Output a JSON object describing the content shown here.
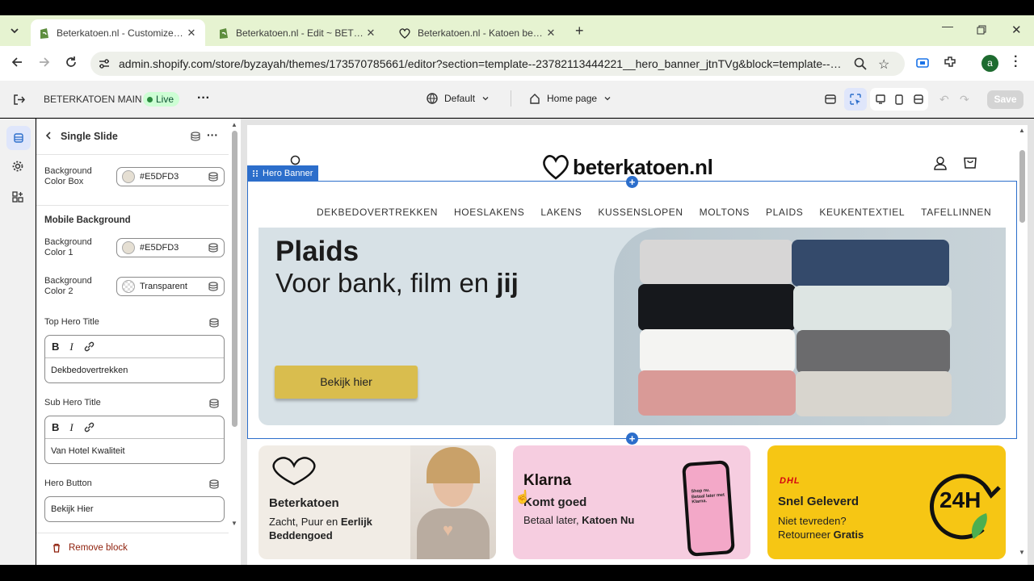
{
  "browser": {
    "tabs": [
      {
        "title": "Beterkatoen.nl - Customize BETERKATOEN MAIN",
        "icon": "shopify-icon"
      },
      {
        "title": "Beterkatoen.nl - Edit ~ BETERKATOEN MAIN",
        "icon": "shopify-icon"
      },
      {
        "title": "Beterkatoen.nl - Katoen beddengoed",
        "icon": "heart-icon"
      }
    ],
    "url": "admin.shopify.com/store/byzayah/themes/173570785661/editor?section=template--23782113444221__hero_banner_jtnTVg&block=template--23782113...",
    "profile_initial": "a"
  },
  "editor": {
    "theme_name": "BETERKATOEN MAIN",
    "live_badge": "Live",
    "more": "···",
    "template_select": "Default",
    "page_select": "Home page",
    "save_label": "Save"
  },
  "panel": {
    "title": "Single Slide",
    "bg_box_label": "Background Color Box",
    "bg_box_value": "#E5DFD3",
    "mobile_heading": "Mobile Background",
    "bg1_label": "Background Color 1",
    "bg1_value": "#E5DFD3",
    "bg2_label": "Background Color 2",
    "bg2_value": "Transparent",
    "top_title_label": "Top Hero Title",
    "top_title_value": "Dekbedovertrekken",
    "sub_title_label": "Sub Hero Title",
    "sub_title_value": "Van Hotel Kwaliteit",
    "hero_button_label": "Hero Button",
    "hero_button_value": "Bekijk Hier",
    "remove_label": "Remove block",
    "bold": "B",
    "italic": "I"
  },
  "site": {
    "logo": "beterkatoen.nl",
    "section_tag": "Hero Banner",
    "nav": [
      "DEKBEDOVERTREKKEN",
      "HOESLAKENS",
      "LAKENS",
      "KUSSENSLOPEN",
      "MOLTONS",
      "PLAIDS",
      "KEUKENTEXTIEL",
      "TAFELLINNEN"
    ],
    "hero": {
      "title": "Plaids",
      "subtitle_pre": "Voor bank, film en ",
      "subtitle_bold": "jij",
      "button": "Bekijk hier"
    },
    "cards": [
      {
        "heading": "Beterkatoen",
        "line1_pre": "Zacht, Puur en ",
        "line1_bold": "Eerlijk Beddengoed"
      },
      {
        "brand": "Klarna",
        "heading": "Komt goed",
        "line1_pre": "Betaal later, ",
        "line1_bold": "Katoen Nu",
        "phone_text": "Shop nu. Betaal later met Klarna."
      },
      {
        "brand": "DHL",
        "heading": "Snel Geleverd",
        "line1": "Niet tevreden?",
        "line2_pre": "Retourneer ",
        "line2_bold": "Gratis",
        "badge": "24H"
      }
    ]
  },
  "colors": {
    "tabbar": "#e6f3d1",
    "hero_bg": "#d7e1e6",
    "button": "#d9bd4e",
    "klarna": "#f6cde0",
    "dhl": "#f6c614",
    "live": "#2a8a3e"
  }
}
